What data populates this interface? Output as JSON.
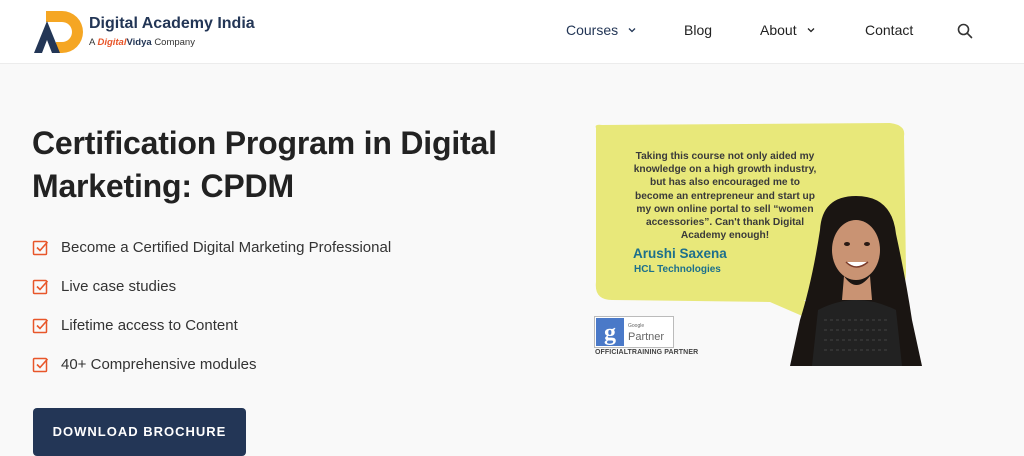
{
  "brand": {
    "name": "Digital Academy India",
    "tagline_prefix": "A",
    "tagline_brand_1": "Digital",
    "tagline_brand_2": "Vidya",
    "tagline_suffix": "Company",
    "colors": {
      "navy": "#233656",
      "orange": "#f5a623",
      "accent": "#e8562a"
    }
  },
  "nav": {
    "items": [
      {
        "label": "Courses",
        "has_dropdown": true,
        "active": true
      },
      {
        "label": "Blog",
        "has_dropdown": false
      },
      {
        "label": "About",
        "has_dropdown": true
      },
      {
        "label": "Contact",
        "has_dropdown": false
      }
    ],
    "search_icon": "search-icon"
  },
  "hero": {
    "title": "Certification Program in Digital Marketing: CPDM",
    "features": [
      "Become a Certified Digital Marketing Professional",
      "Live case studies",
      "Lifetime access to Content",
      "40+ Comprehensive modules"
    ],
    "feature_icon": "checkbox-icon",
    "cta_label": "DOWNLOAD BROCHURE"
  },
  "testimonial": {
    "quote": "Taking this course not only aided my knowledge on a high growth industry, but has also encouraged me to become an entrepreneur and start up my own online portal to sell “women accessories”. Can't thank Digital Academy enough!",
    "name": "Arushi Saxena",
    "company": "HCL Technologies",
    "badge_small": "Google",
    "badge_big": "Partner",
    "badge_caption": "OFFICIALTRAINING PARTNER",
    "bubble_color": "#e8e87a"
  }
}
